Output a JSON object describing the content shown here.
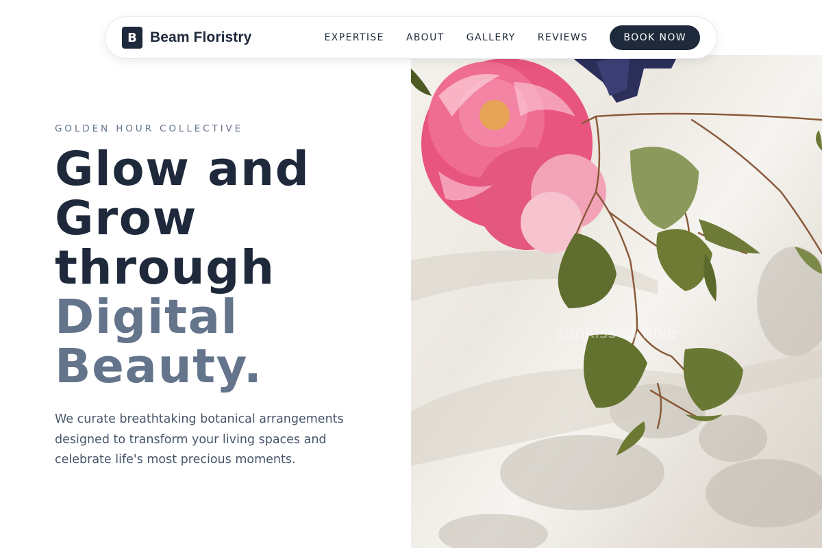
{
  "brand": {
    "mark": "B",
    "name": "Beam Floristry"
  },
  "nav": {
    "links": [
      "EXPERTISE",
      "ABOUT",
      "GALLERY",
      "REVIEWS"
    ],
    "cta_label": "BOOK NOW"
  },
  "hero": {
    "eyebrow": "GOLDEN HOUR COLLECTIVE",
    "headline_lines": [
      "Glow and",
      "Grow",
      "through"
    ],
    "headline_accent_lines": [
      "Digital",
      "Beauty."
    ],
    "description": "We curate breathtaking botanical arrangements designed to transform your living spaces and celebrate life's most precious moments.",
    "image_watermark": "sunkissed hive"
  },
  "colors": {
    "primary": "#1e293b",
    "accent_text": "#64748b",
    "body_text": "#475569",
    "peony_pink": "#ec5b8a",
    "leaf_green": "#6b7a3c"
  }
}
